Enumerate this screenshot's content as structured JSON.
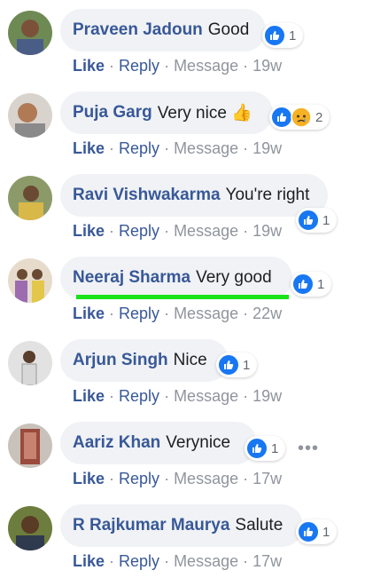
{
  "comments": [
    {
      "name": "Praveen Jadoun",
      "text": "Good",
      "reaction_count": "1",
      "time": "19w"
    },
    {
      "name": "Puja Garg",
      "text": "Very nice 👍",
      "reaction_count": "2",
      "time": "19w"
    },
    {
      "name": "Ravi Vishwakarma",
      "text": "You're right",
      "reaction_count": "1",
      "time": "19w"
    },
    {
      "name": "Neeraj Sharma",
      "text": "Very good",
      "reaction_count": "1",
      "time": "22w"
    },
    {
      "name": "Arjun Singh",
      "text": "Nice",
      "reaction_count": "1",
      "time": "19w"
    },
    {
      "name": "Aariz Khan",
      "text": "Verynice",
      "reaction_count": "1",
      "time": "17w"
    },
    {
      "name": "R Rajkumar Maurya",
      "text": "Salute",
      "reaction_count": "1",
      "time": "17w"
    }
  ],
  "actions": {
    "like": "Like",
    "reply": "Reply",
    "message": "Message",
    "sep": "·"
  },
  "more_menu": "•••",
  "colors": {
    "name": "#385898",
    "muted": "#90949c",
    "bubble": "#f0f2f5",
    "like_blue": "#1877f2",
    "highlight": "#19e319"
  }
}
